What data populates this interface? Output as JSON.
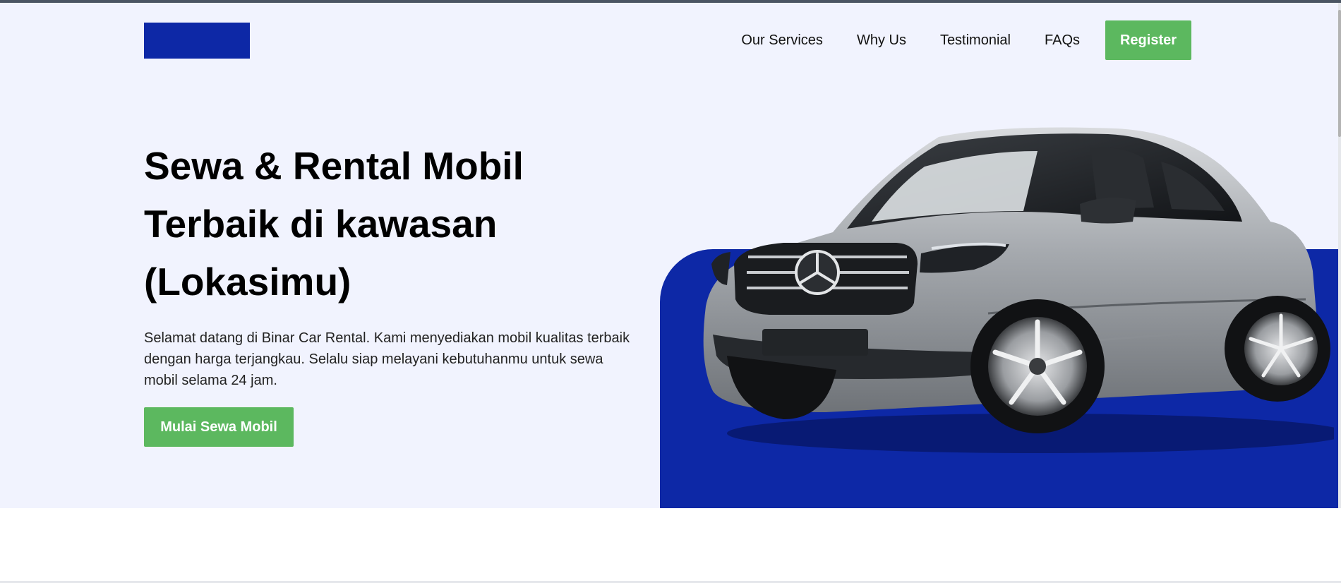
{
  "colors": {
    "brand_blue": "#0d28a6",
    "hero_bg": "#f1f3fe",
    "button_green": "#5cb85f"
  },
  "header": {
    "logo_icon": "brand-logo-block",
    "nav": [
      {
        "label": "Our Services"
      },
      {
        "label": "Why Us"
      },
      {
        "label": "Testimonial"
      },
      {
        "label": "FAQs"
      }
    ],
    "register_label": "Register"
  },
  "hero": {
    "title_line1": "Sewa & Rental Mobil",
    "title_line2": "Terbaik di kawasan",
    "title_line3": "(Lokasimu)",
    "description": "Selamat datang di Binar Car Rental. Kami menyediakan mobil kualitas terbaik dengan harga terjangkau. Selalu siap melayani kebutuhanmu untuk sewa mobil selama 24 jam.",
    "cta_label": "Mulai Sewa Mobil",
    "image_icon": "car-image"
  }
}
